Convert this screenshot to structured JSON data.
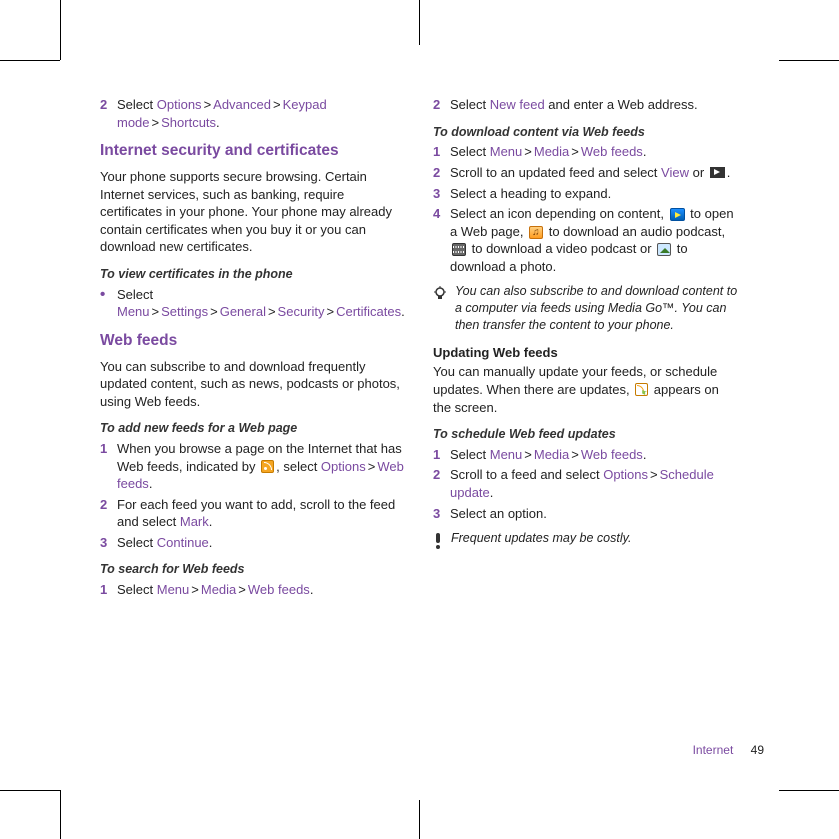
{
  "gt": ">",
  "left": {
    "bc_pre": {
      "num": "2",
      "t1": "Select ",
      "o": "Options",
      "a": "Advanced",
      "k": "Keypad mode",
      "s": "Shortcuts",
      "dot": "."
    },
    "sect1": "Internet security and certificates",
    "p1": "Your phone supports secure browsing. Certain Internet services, such as banking, require certificates in your phone. Your phone may already contain certificates when you buy it or you can download new certificates.",
    "subh1": "To view certificates in the phone",
    "certs": {
      "t1": "Select ",
      "m": "Menu",
      "s": "Settings",
      "g": "General",
      "sec": "Security",
      "c": "Certificates",
      "dot": "."
    },
    "sect2": "Web feeds",
    "p2": "You can subscribe to and download frequently updated content, such as news, podcasts or photos, using Web feeds.",
    "subh2": "To add new feeds for a Web page",
    "steps_add": [
      {
        "num": "1",
        "pre": "When you browse a page on the Internet that has Web feeds, indicated by ",
        "mid": ", select ",
        "o": "Options",
        "w": "Web feeds",
        "dot": "."
      },
      {
        "num": "2",
        "pre": "For each feed you want to add, scroll to the feed and select ",
        "m": "Mark",
        "dot": "."
      },
      {
        "num": "3",
        "pre": "Select ",
        "c": "Continue",
        "dot": "."
      }
    ],
    "subh3": "To search for Web feeds",
    "steps_search": {
      "num": "1",
      "t1": "Select ",
      "m": "Menu",
      "me": "Media",
      "w": "Web feeds",
      "dot": "."
    }
  },
  "right": {
    "step2": {
      "num": "2",
      "t1": "Select ",
      "nf": "New feed",
      "t2": " and enter a Web address."
    },
    "subh1": "To download content via Web feeds",
    "steps_dl": [
      {
        "num": "1",
        "t1": "Select ",
        "m": "Menu",
        "me": "Media",
        "w": "Web feeds",
        "dot": "."
      },
      {
        "num": "2",
        "t1": "Scroll to an updated feed and select ",
        "v": "View",
        "or": " or ",
        "dot": "."
      },
      {
        "num": "3",
        "t1": "Select a heading to expand."
      },
      {
        "num": "4",
        "pre": "Select an icon depending on content, ",
        "a1": " to open a Web page, ",
        "a2": " to download an audio podcast, ",
        "a3": " to download a video podcast or ",
        "a4": " to download a photo."
      }
    ],
    "tip1": "You can also subscribe to and download content to a computer via feeds using Media Go™. You can then transfer the content to your phone.",
    "subh2": "Updating Web feeds",
    "p_upd": {
      "t1": "You can manually update your feeds, or schedule updates. When there are updates, ",
      "t2": " appears on the screen."
    },
    "subh3": "To schedule Web feed updates",
    "steps_sched": [
      {
        "num": "1",
        "t1": "Select ",
        "m": "Menu",
        "me": "Media",
        "w": "Web feeds",
        "dot": "."
      },
      {
        "num": "2",
        "t1": "Scroll to a feed and select ",
        "o": "Options",
        "s": "Schedule update",
        "dot": "."
      },
      {
        "num": "3",
        "t1": "Select an option."
      }
    ],
    "tip2": "Frequent updates may be costly."
  },
  "footer": {
    "section": "Internet",
    "page": "49"
  }
}
